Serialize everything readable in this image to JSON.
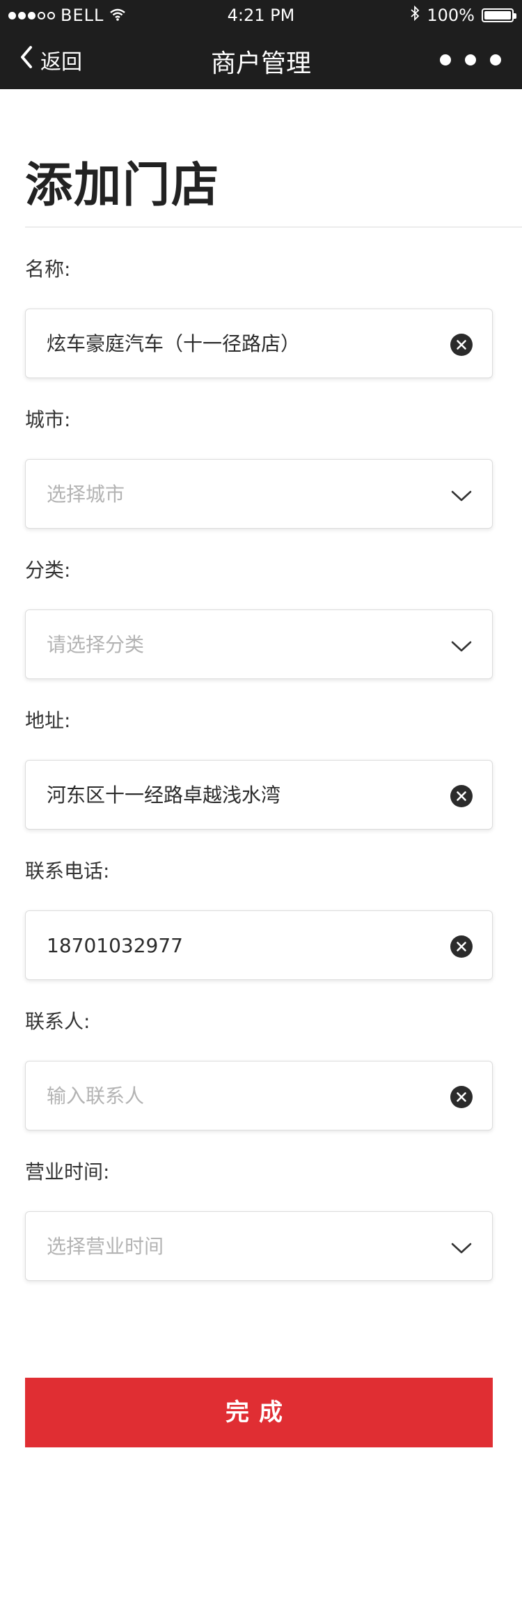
{
  "status_bar": {
    "carrier": "BELL",
    "time": "4:21 PM",
    "battery": "100%"
  },
  "nav": {
    "back_label": "返回",
    "title": "商户管理"
  },
  "page_title": "添加门店",
  "form": {
    "name": {
      "label": "名称:",
      "value": "炫车豪庭汽车（十一径路店）"
    },
    "city": {
      "label": "城市:",
      "placeholder": "选择城市"
    },
    "category": {
      "label": "分类:",
      "placeholder": "请选择分类"
    },
    "address": {
      "label": "地址:",
      "value": "河东区十一经路卓越浅水湾"
    },
    "phone": {
      "label": "联系电话:",
      "value": "18701032977"
    },
    "contact": {
      "label": "联系人:",
      "placeholder": "输入联系人"
    },
    "hours": {
      "label": "营业时间:",
      "placeholder": "选择营业时间"
    }
  },
  "done_label": "完成",
  "colors": {
    "accent": "#e02e33",
    "nav_bg": "#1e1e1e"
  }
}
